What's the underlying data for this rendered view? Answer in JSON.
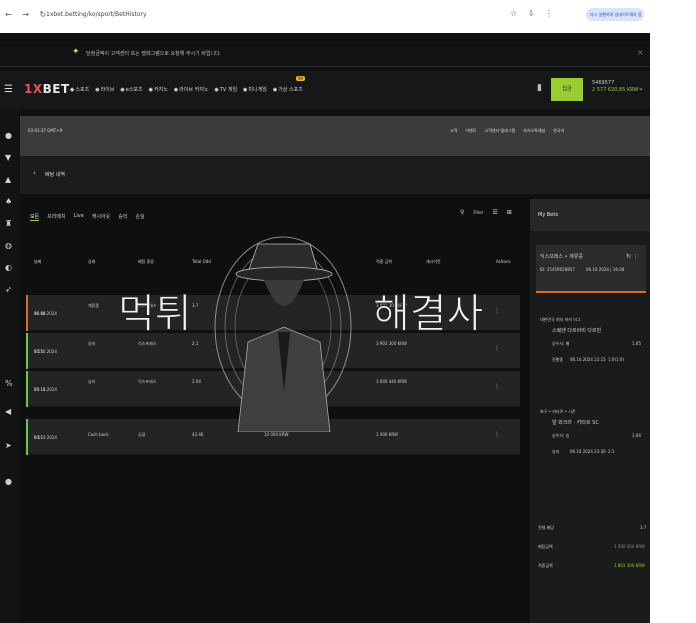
{
  "browser": {
    "url": "1xbet.betting/ko/sport/BetHistory",
    "profile_label": "다시 실행하여 업데이트해야 함"
  },
  "notice": {
    "message": "당첨금액이 고객센터 또는 텔레그램으로 요청해 주시기 바랍니다."
  },
  "topnav": {
    "logo_prefix": "1X",
    "logo_suffix": "BET",
    "menu": [
      "스포츠",
      "라이브",
      "e스포츠",
      "카지노",
      "라이브 카지노",
      "TV 게임",
      "미니게임",
      "가상 스포츠"
    ],
    "badge": "99",
    "deposit_label": "입금",
    "account_id": "5469577",
    "balance": "2 577 620.85 KRW"
  },
  "subbar": {
    "time": "03:03:37 GMT+9",
    "tools": [
      "고객",
      "이벤트",
      "고객센터 텔레그램",
      "카카오톡채널",
      "한국어"
    ]
  },
  "history_title": "베팅 내역",
  "filters": [
    "모든",
    "프리매치",
    "Live",
    "캐시아웃",
    "승리",
    "손실"
  ],
  "filter_label": "Filter",
  "table": {
    "headers": [
      "날짜",
      "상태",
      "베팅 종류",
      "Total Odd",
      "금액",
      "적중 금액",
      "캐시아웃",
      "Actions"
    ],
    "rows": [
      {
        "date": "06.10.2024",
        "time": "16:08",
        "status": "계류중",
        "type": "익스프레스",
        "odd": "3.7",
        "amount": "",
        "win": "3 801 300 KRW",
        "status_color": "#e06a2b"
      },
      {
        "date": "05.10.2024",
        "time": "1:55",
        "status": "승리",
        "type": "익스프레스",
        "odd": "2.1",
        "amount": "",
        "win": "3 903 300 KRW",
        "status_color": "#6cc24a"
      },
      {
        "date": "05.10.2024",
        "time": "23:11",
        "status": "승리",
        "type": "익스프레스",
        "odd": "2.64",
        "amount": "",
        "win": "3 640 440 KRW",
        "status_color": "#6cc24a"
      },
      {
        "date": "03.10.2024",
        "time": "9:01",
        "status": "Cash back",
        "type": "싱글",
        "odd": "43.46",
        "amount": "10 000 KRW",
        "win": "1 000 KRW",
        "status_color": "#6cc24a"
      }
    ]
  },
  "rpanel": {
    "title": "My Bets",
    "card1": {
      "name": "익스프레스 • 계류중",
      "id": "ID: 25459028857",
      "date": "06.10.2024 | 16:08"
    },
    "card2": {
      "league": "대한민국 여자 하키 리그",
      "match": "스웨덴 다르비비 다르빈",
      "pick_label": "승우사: 패",
      "odd": "1.65",
      "status": "진행중",
      "date": "06.10.2024 22:15",
      "score": "1:0(1:0)"
    },
    "card3": {
      "league": "축구 • 카타르 • 시즌",
      "match": "알 와크라 · 카타르 SC",
      "pick_label": "승우사: 승",
      "odd": "1.64",
      "status": "승리",
      "date": "06.10.2024 23:30",
      "score": "2:1"
    },
    "footer": [
      {
        "label": "전체 배당",
        "value": "3.7"
      },
      {
        "label": "베팅금액",
        "value": "1 000 000 KRW"
      },
      {
        "label": "적중금액",
        "value": "3 801 300 KRW"
      }
    ]
  },
  "watermark": {
    "left": "먹튀",
    "right": "해결사"
  },
  "colors": {
    "accent": "#9acd32",
    "background": "#0e0f10",
    "pending": "#e06a2b",
    "won": "#6cc24a"
  }
}
